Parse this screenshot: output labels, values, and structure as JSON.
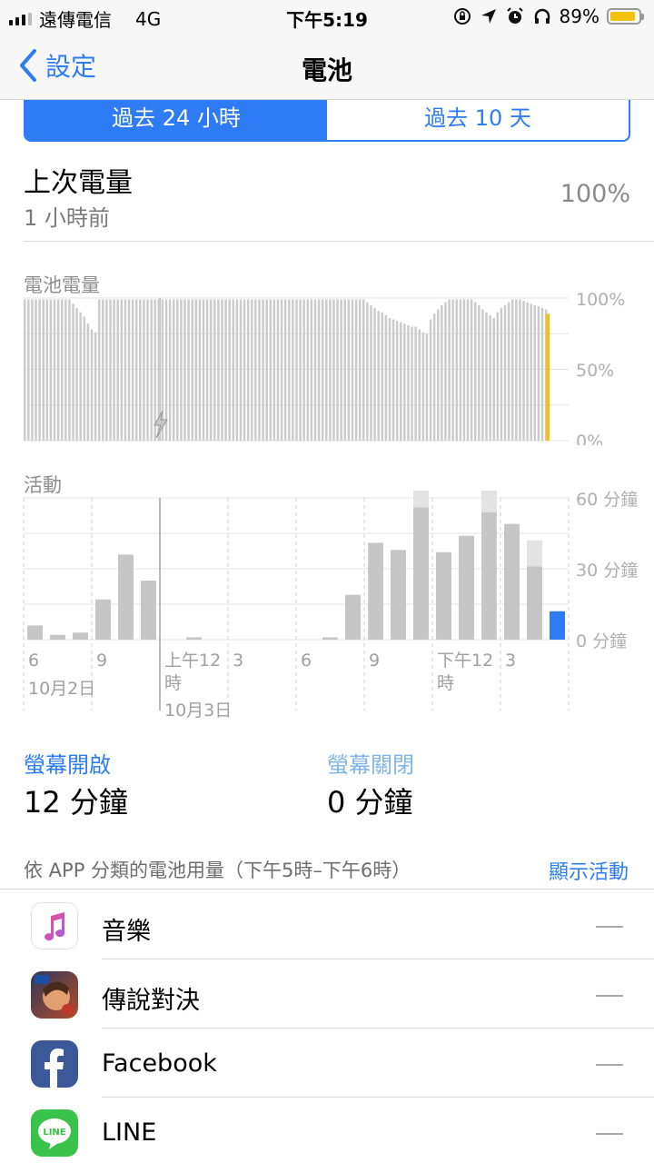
{
  "status_bar": {
    "carrier": "遠傳電信",
    "network": "4G",
    "time": "下午5:19",
    "battery_percent": "89%",
    "battery_level": 0.89
  },
  "nav": {
    "back_label": "設定",
    "title": "電池"
  },
  "segment": {
    "options": [
      "過去 24 小時",
      "過去 10 天"
    ],
    "selected": 0
  },
  "last_charge": {
    "label": "上次電量",
    "sub": "1 小時前",
    "value": "100%"
  },
  "battery_chart": {
    "title": "電池電量",
    "y_ticks": [
      "100%",
      "50%",
      "0%"
    ]
  },
  "activity_chart": {
    "title": "活動",
    "y_ticks": [
      "60 分鐘",
      "30 分鐘",
      "0 分鐘"
    ],
    "x_ticks": [
      "6",
      "9",
      "上午12",
      "時",
      "3",
      "6",
      "9",
      "下午12",
      "時",
      "3"
    ],
    "date_labels": [
      "10月2日",
      "10月3日"
    ]
  },
  "chart_data": [
    {
      "type": "bar",
      "title": "電池電量",
      "ylim": [
        0,
        100
      ],
      "y_ticks": [
        "100%",
        "50%",
        "0%"
      ],
      "charging_marker_index": 19,
      "values": [
        99,
        99,
        99,
        99,
        99,
        99,
        99,
        99,
        99,
        99,
        99,
        99,
        99,
        96,
        93,
        90,
        87,
        82,
        78,
        76,
        99,
        99,
        99,
        99,
        99,
        99,
        99,
        99,
        99,
        99,
        99,
        99,
        99,
        99,
        99,
        99,
        99,
        99,
        99,
        99,
        99,
        99,
        99,
        99,
        99,
        99,
        99,
        99,
        99,
        99,
        99,
        99,
        99,
        99,
        99,
        99,
        99,
        99,
        99,
        99,
        99,
        99,
        99,
        99,
        99,
        99,
        99,
        99,
        99,
        99,
        99,
        99,
        99,
        99,
        99,
        99,
        99,
        99,
        99,
        99,
        99,
        99,
        99,
        99,
        99,
        99,
        99,
        99,
        99,
        99,
        99,
        99,
        97,
        95,
        93,
        91,
        90,
        88,
        86,
        85,
        84,
        83,
        82,
        81,
        80,
        80,
        78,
        76,
        75,
        85,
        89,
        92,
        95,
        97,
        99,
        99,
        99,
        99,
        99,
        99,
        99,
        97,
        95,
        92,
        90,
        88,
        86,
        90,
        93,
        95,
        97,
        99,
        99,
        99,
        98,
        97,
        96,
        95,
        94,
        93,
        92
      ],
      "current_value": 89
    },
    {
      "type": "bar",
      "title": "活動",
      "ylim": [
        0,
        60
      ],
      "y_ticks": [
        "60 分鐘",
        "30 分鐘",
        "0 分鐘"
      ],
      "series": [
        {
          "name": "螢幕開啟",
          "values": [
            6,
            2,
            3,
            17,
            36,
            25,
            0,
            1,
            0,
            0,
            0,
            0,
            0,
            1,
            19,
            41,
            38,
            56,
            37,
            44,
            54,
            49,
            31,
            12
          ]
        },
        {
          "name": "螢幕關閉",
          "values": [
            0,
            0,
            0,
            0,
            0,
            0,
            0,
            0,
            0,
            0,
            0,
            0,
            0,
            0,
            0,
            0,
            0,
            10,
            0,
            0,
            10,
            0,
            11,
            0
          ]
        }
      ],
      "highlight_index": 23
    }
  ],
  "screen_stats": {
    "on_label": "螢幕開啟",
    "on_value": "12 分鐘",
    "off_label": "螢幕關閉",
    "off_value": "0 分鐘"
  },
  "apps": {
    "header": "依 APP 分類的電池用量（下午5時–下午6時）",
    "link": "顯示活動",
    "items": [
      {
        "name": "音樂",
        "usage": "—",
        "icon": "music-icon"
      },
      {
        "name": "傳說對決",
        "usage": "—",
        "icon": "game-icon"
      },
      {
        "name": "Facebook",
        "usage": "—",
        "icon": "facebook-icon"
      },
      {
        "name": "LINE",
        "usage": "—",
        "icon": "line-icon"
      }
    ]
  },
  "colors": {
    "accent": "#2d7cf6",
    "battery_highlight": "#f4c20d",
    "bar": "#c6c6c6"
  }
}
